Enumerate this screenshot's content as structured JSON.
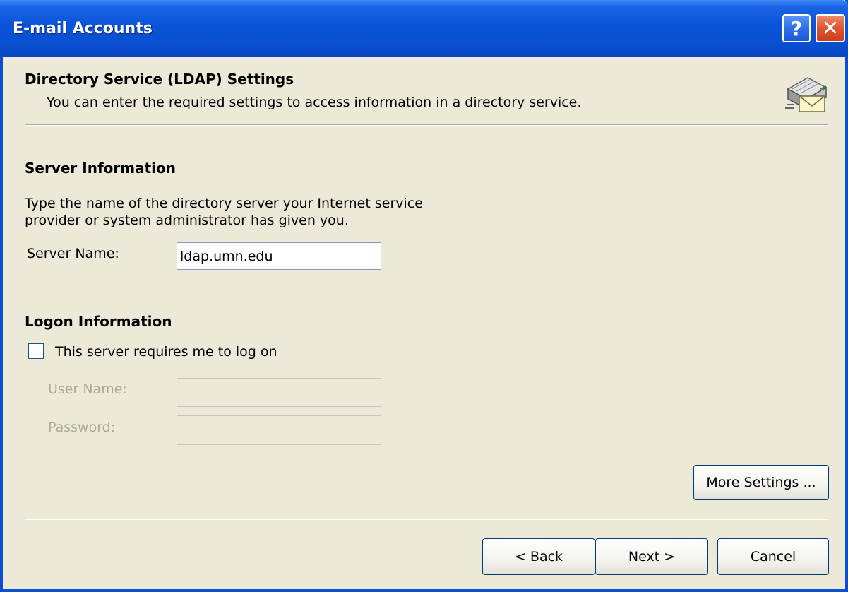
{
  "window": {
    "title": "E-mail Accounts",
    "help_glyph": "?",
    "close_glyph": "✕"
  },
  "header": {
    "title": "Directory Service (LDAP) Settings",
    "subtitle": "You can enter the required settings to access information in a directory service.",
    "icon": "address-book-icon"
  },
  "server_info": {
    "title": "Server Information",
    "description_line1": "Type the name of the directory server your Internet service",
    "description_line2": "provider or system administrator has given you.",
    "server_name_label": "Server Name:",
    "server_name_value": "ldap.umn.edu"
  },
  "logon_info": {
    "title": "Logon Information",
    "requires_logon_label": "This server requires me to log on",
    "requires_logon_checked": false,
    "user_name_label": "User Name:",
    "user_name_value": "",
    "password_label": "Password:",
    "password_value": ""
  },
  "buttons": {
    "more_settings": "More Settings ...",
    "back": "< Back",
    "next": "Next >",
    "cancel": "Cancel"
  },
  "colors": {
    "titlebar": "#0a4fd0",
    "dialog_bg": "#ece9d8",
    "disabled_text": "#aca899",
    "close_button": "#e0552e"
  }
}
